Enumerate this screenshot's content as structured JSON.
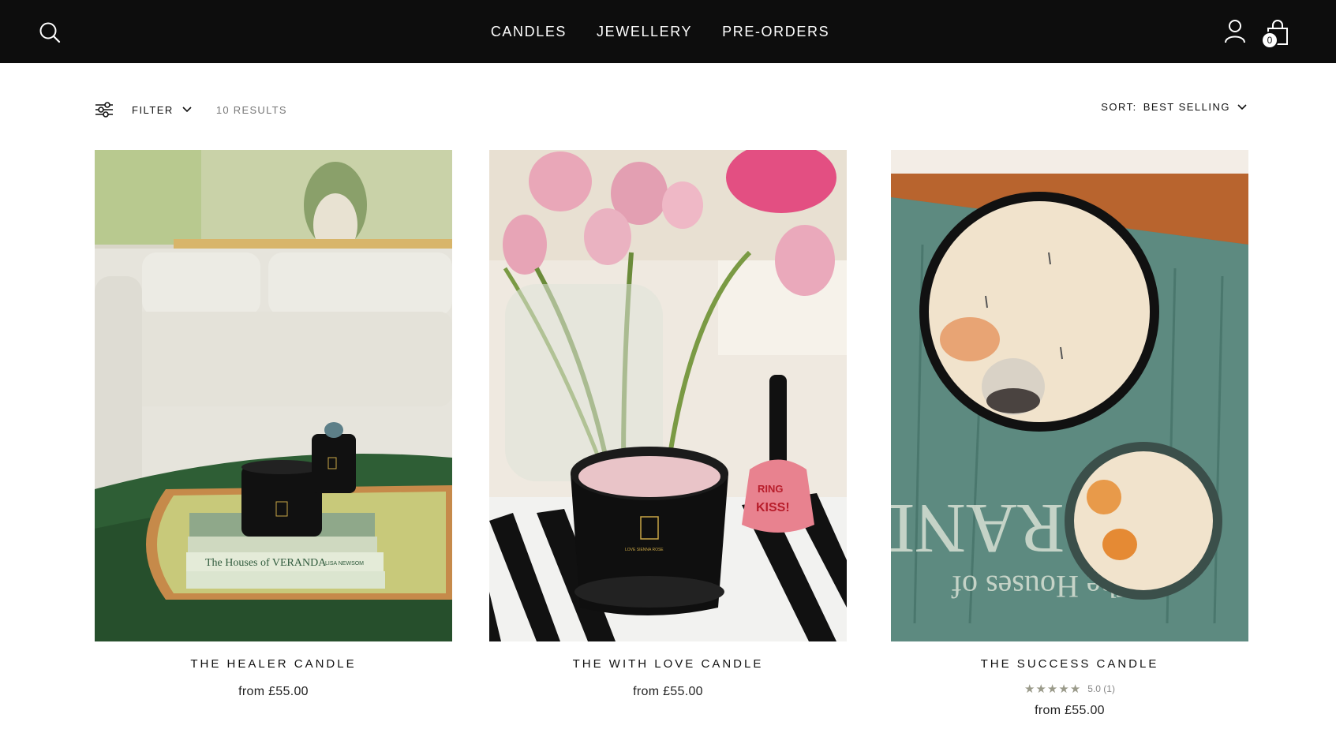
{
  "header": {
    "nav": [
      {
        "label": "CANDLES"
      },
      {
        "label": "JEWELLERY"
      },
      {
        "label": "PRE-ORDERS"
      }
    ],
    "cart_count": "0",
    "icons": {
      "search": "search-icon",
      "account": "user-icon",
      "cart": "shopping-bag-icon"
    },
    "background": "#0d0d0d"
  },
  "toolbar": {
    "filter_label": "FILTER",
    "results": "10 RESULTS",
    "sort_label": "SORT:",
    "sort_value": "BEST SELLING"
  },
  "products": [
    {
      "title": "THE HEALER CANDLE",
      "price": "from £55.00"
    },
    {
      "title": "THE WITH LOVE CANDLE",
      "price": "from £55.00"
    },
    {
      "title": "THE SUCCESS CANDLE",
      "price": "from £55.00",
      "rating_stars": "★★★★★",
      "rating_text": "5.0 (1)",
      "rating_value": 5.0,
      "review_count": 1
    }
  ],
  "image_texts": {
    "book_title_1": "The Houses of VERANDA",
    "book_author_1": "LISA NEWSOM",
    "bell_text_1": "RING",
    "bell_text_2": "KISS!",
    "candle_brand": "LOVE SIENNA ROSE",
    "book_title_3": "The Houses of",
    "book_title_3b": "VERAND"
  }
}
